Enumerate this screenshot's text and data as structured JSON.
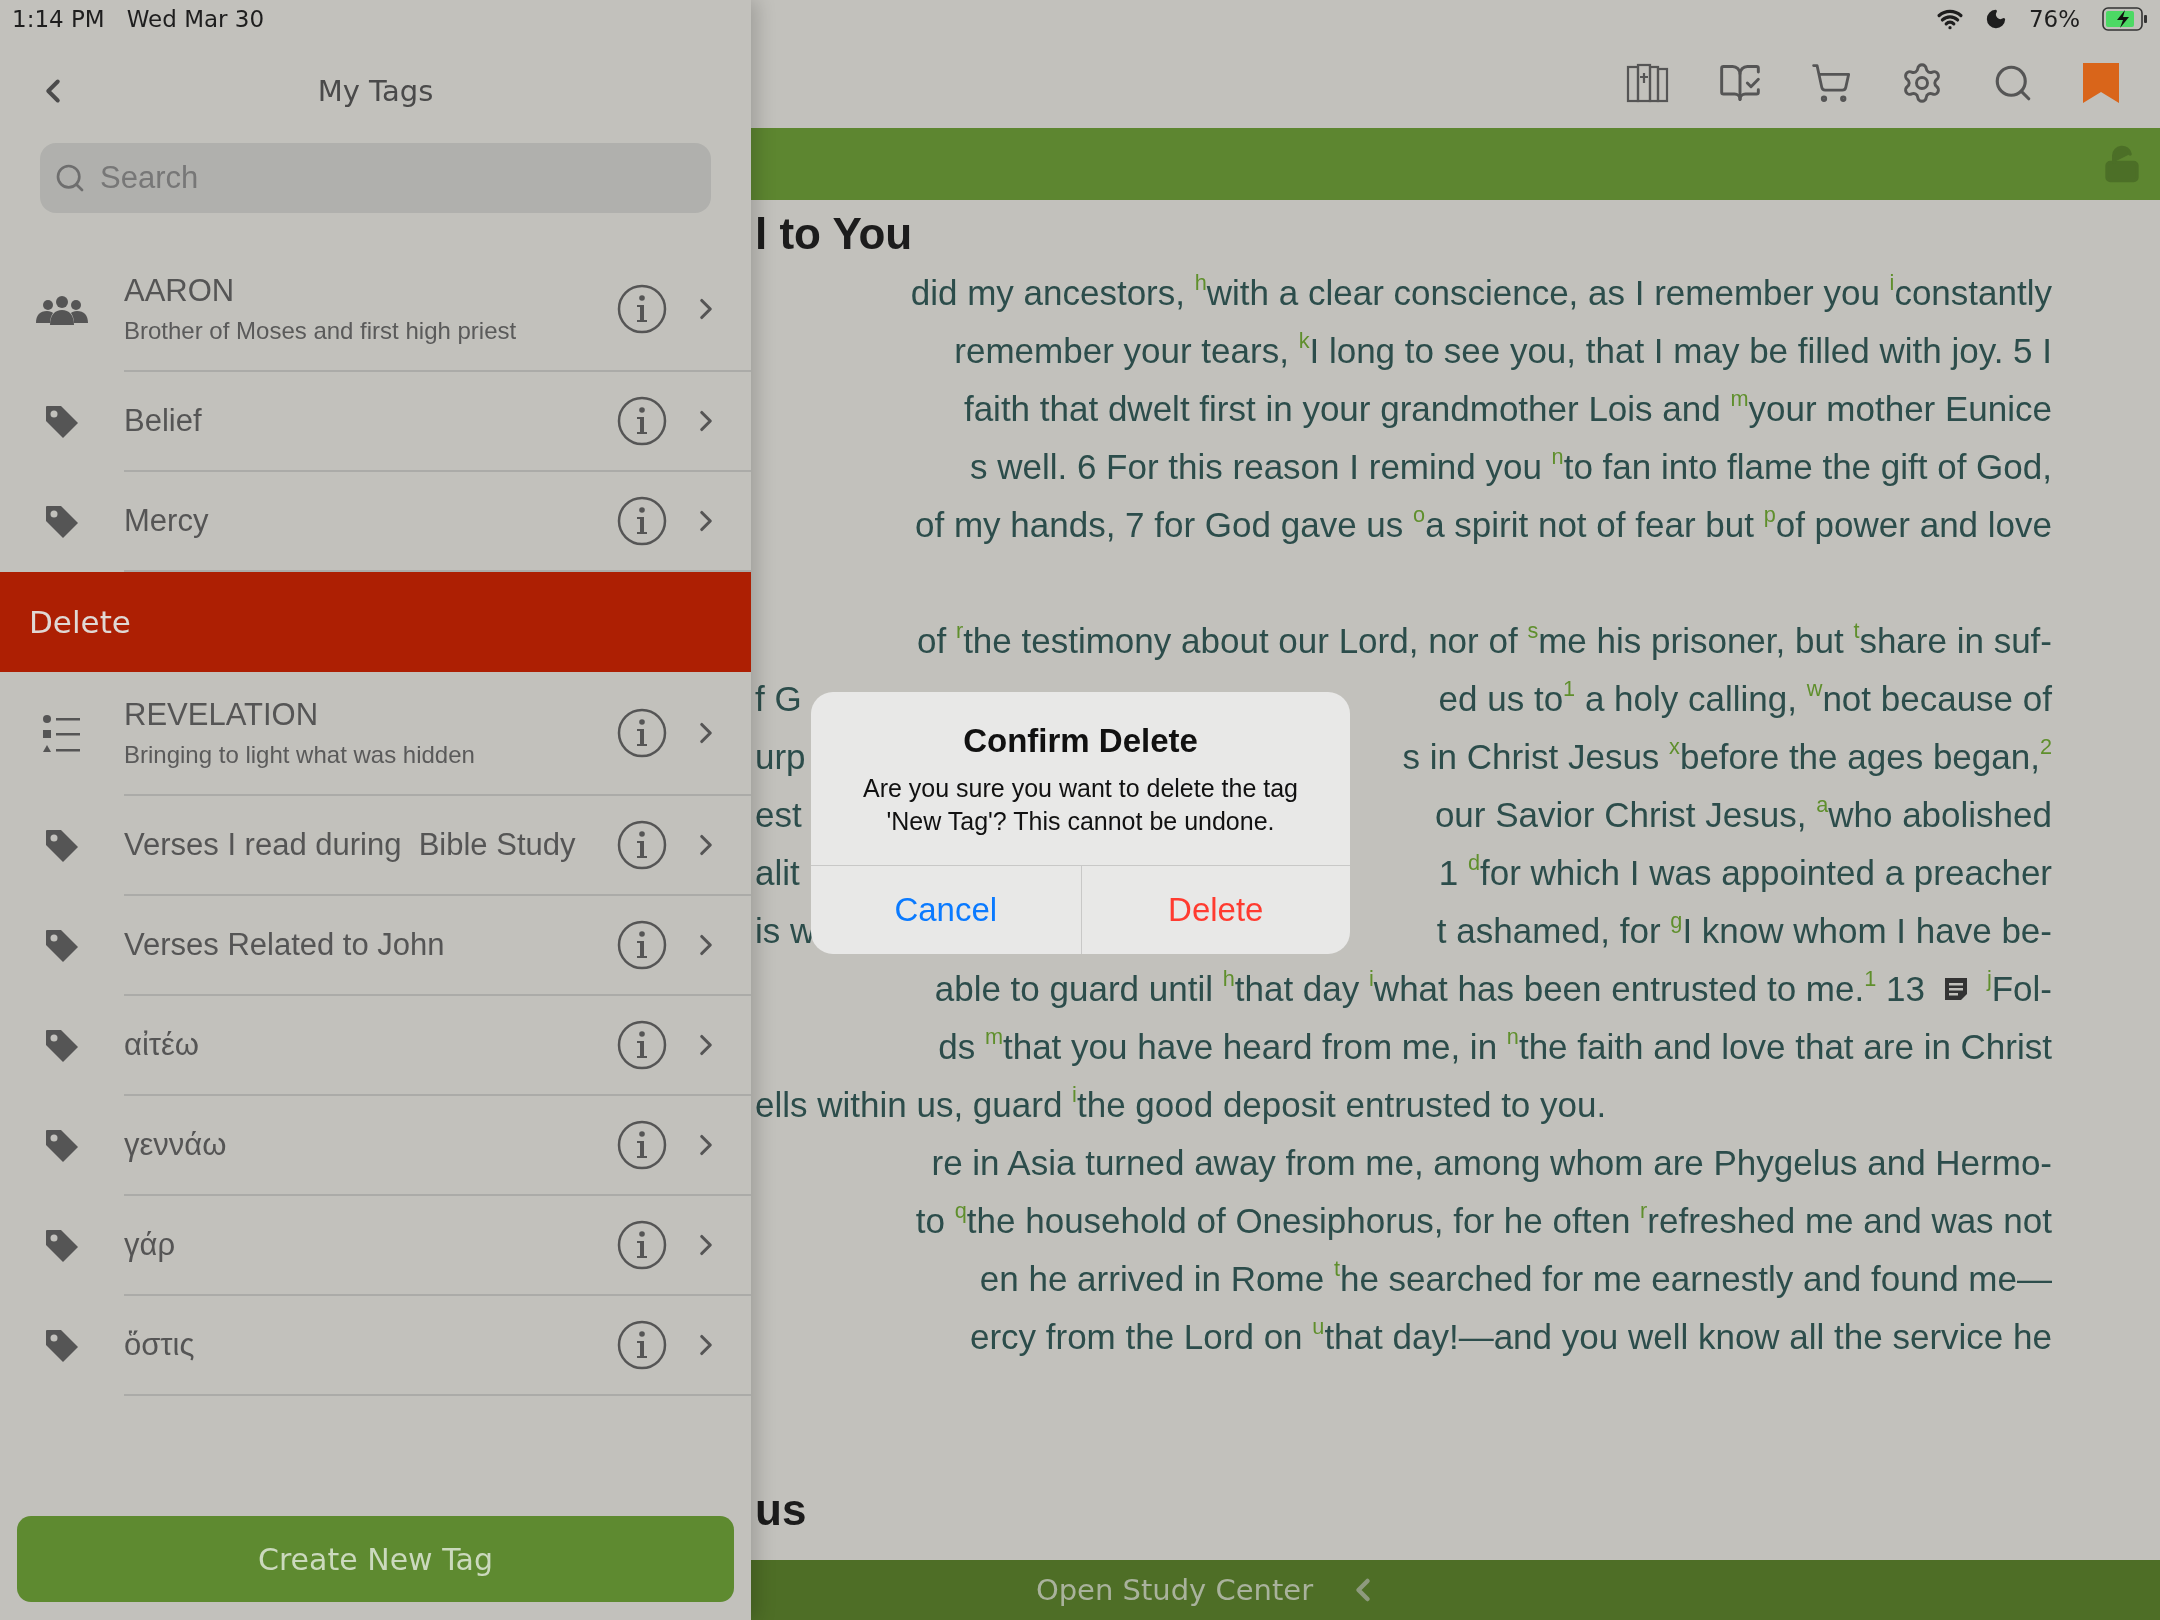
{
  "status_bar": {
    "time": "1:14 PM",
    "date": "Wed Mar 30",
    "battery": "76%"
  },
  "sidebar": {
    "title": "My Tags",
    "search": {
      "placeholder": "Search"
    },
    "items": [
      {
        "kind": "person",
        "label": "AARON",
        "subtitle": "Brother of Moses and first high priest"
      },
      {
        "kind": "tag",
        "label": "Belief"
      },
      {
        "kind": "tag",
        "label": "Mercy"
      },
      {
        "kind": "delete",
        "label": "Delete"
      },
      {
        "kind": "list",
        "label": "REVELATION",
        "subtitle": "Bringing to light what was hidden"
      },
      {
        "kind": "tag",
        "label": "Verses I read during  Bible Study"
      },
      {
        "kind": "tag",
        "label": "Verses Related to John"
      },
      {
        "kind": "tag",
        "label": "αἰτέω"
      },
      {
        "kind": "tag",
        "label": "γεννάω"
      },
      {
        "kind": "tag",
        "label": "γάρ"
      },
      {
        "kind": "tag",
        "label": "ὅστις"
      }
    ],
    "create_button": "Create New Tag"
  },
  "reader": {
    "heading": "l to You",
    "lines": [
      {
        "kind": "full",
        "segments": [
          "did my ancestors, $^{h}$with a clear conscience, as I remember you $^{i}$constantly"
        ]
      },
      {
        "kind": "full",
        "segments": [
          "remember your tears, $^{k}$I long to see you, that I may be filled with joy.  5 I"
        ]
      },
      {
        "kind": "full",
        "segments": [
          "faith that dwelt first in your grandmother Lois and $^{m}$your mother Eunice"
        ]
      },
      {
        "kind": "full",
        "segments": [
          "s well.  6 For this reason I remind you $^{n}$to fan into flame the gift of God,"
        ]
      },
      {
        "kind": "full",
        "segments": [
          "of my hands,  7 for God gave us $^{o}$a spirit not of fear but $^{p}$of power and love"
        ]
      },
      {
        "kind": "full",
        "space_before": true,
        "segments": [
          "of $^{r}$the testimony about our Lord, nor of $^{s}$me his prisoner, but $^{t}$share in suf-"
        ]
      },
      {
        "kind": "split",
        "segments": [
          "f G",
          "ed us to$^{1}$ a holy calling, $^{w}$not because of"
        ]
      },
      {
        "kind": "split",
        "segments": [
          "urp",
          "s in Christ Jesus $^{x}$before the ages began,$^{2}$"
        ]
      },
      {
        "kind": "split",
        "segments": [
          "est",
          "our Savior Christ Jesus, $^{a}$who abolished"
        ]
      },
      {
        "kind": "split",
        "segments": [
          "alit",
          "1 $^{d}$for which I was appointed a preacher"
        ]
      },
      {
        "kind": "split",
        "segments": [
          "is w",
          "t ashamed, for $^{g}$I know whom I have be-"
        ]
      },
      {
        "kind": "note",
        "segments": [
          "able to guard until $^{h}$that day $^{i}$what has been entrusted to me.$^{1}$  13",
          "$^{j}$Fol-"
        ]
      },
      {
        "kind": "full",
        "segments": [
          "ds $^{m}$that you have heard from me, in $^{n}$the faith and love that are in Christ"
        ]
      },
      {
        "kind": "end",
        "segments": [
          "ells within us, guard $^{i}$the good deposit entrusted to you."
        ]
      },
      {
        "kind": "full",
        "segments": [
          "re in Asia turned away from me, among whom are Phygelus and Hermo-"
        ]
      },
      {
        "kind": "full",
        "segments": [
          "to $^{q}$the household of Onesiphorus, for he often $^{r}$refreshed me and was not"
        ]
      },
      {
        "kind": "full",
        "segments": [
          "en he arrived in Rome $^{t}$he searched for me earnestly and found me—"
        ]
      },
      {
        "kind": "full",
        "segments": [
          "ercy from the Lord on $^{u}$that day!—and you well know all the service he"
        ]
      }
    ],
    "bottom_heading": "us",
    "study_center": "Open Study Center"
  },
  "dialog": {
    "title": "Confirm Delete",
    "message": "Are you sure you want to delete the tag 'New Tag'? This cannot be undone.",
    "buttons": [
      {
        "label": "Cancel",
        "kind": "cancel"
      },
      {
        "label": "Delete",
        "kind": "destructive"
      }
    ]
  }
}
